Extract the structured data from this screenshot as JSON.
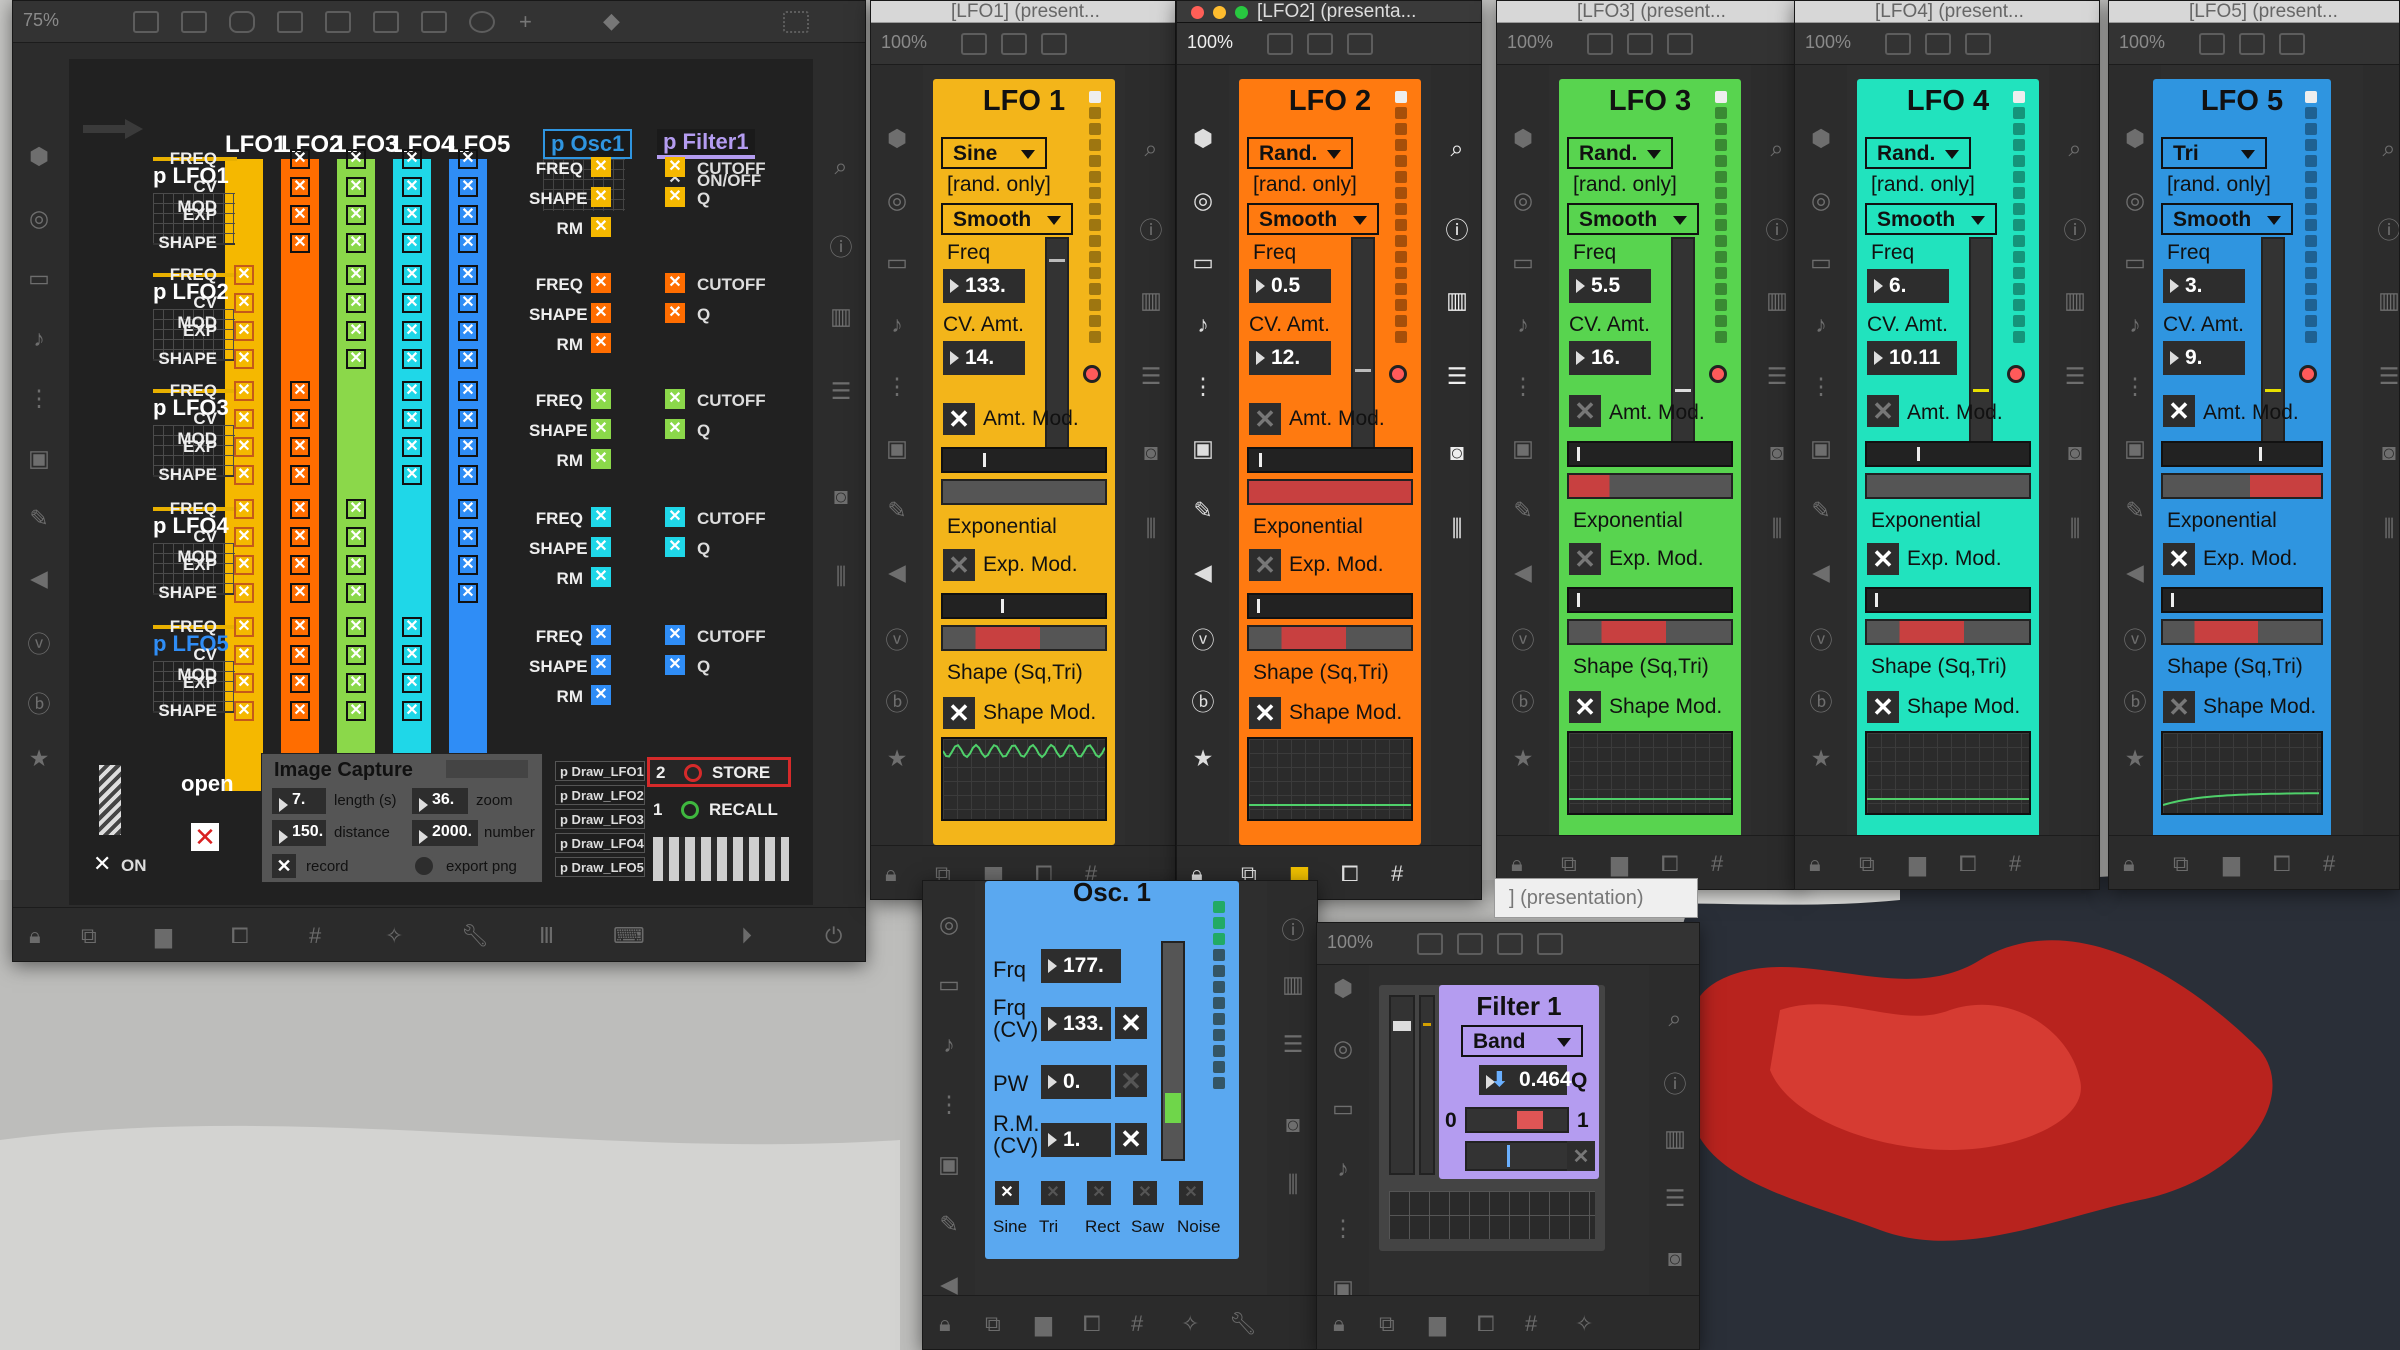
{
  "main_window": {
    "zoom": "75%"
  },
  "matrix": {
    "columns": [
      "LFO1",
      "LFO2",
      "LFO3",
      "LFO4",
      "LFO5"
    ],
    "column_colors": [
      "#f5b800",
      "#ff6d00",
      "#8bd84a",
      "#1fd7e8",
      "#2f8df6"
    ],
    "row_labels": [
      "FREQ",
      "CV MOD",
      "EXP",
      "SHAPE"
    ],
    "preset_names": [
      "p LFO1",
      "p LFO2",
      "p LFO3",
      "p LFO4",
      "p LFO5"
    ],
    "osc_label": "p Osc1",
    "osc_rows": [
      "FREQ",
      "SHAPE",
      "RM"
    ],
    "filter_label": "p Filter1",
    "filter_onoff": "ON/OFF",
    "filter_cutoff": "CUTOFF",
    "filter_q": "Q"
  },
  "controls": {
    "open_label": "open",
    "on_label": "ON"
  },
  "capture": {
    "title": "Image Capture",
    "length_value": "7.",
    "length_label": "length (s)",
    "zoom_value": "36.",
    "zoom_label": "zoom",
    "distance_value": "150.",
    "distance_label": "distance",
    "number_value": "2000.",
    "number_label": "number",
    "record_label": "record",
    "export_label": "export png",
    "draw_items": [
      "p Draw_LFO1",
      "p Draw_LFO2",
      "p Draw_LFO3",
      "p Draw_LFO4",
      "p Draw_LFO5"
    ],
    "store_num": "2",
    "store_label": "STORE",
    "recall_num": "1",
    "recall_label": "RECALL"
  },
  "window_titles": {
    "lfo1": "[LFO1] (present...",
    "lfo2": "[LFO2] (presenta...",
    "lfo3": "[LFO3] (present...",
    "lfo4": "[LFO4] (present...",
    "lfo5": "[LFO5] (present...",
    "osc": "] (presentation)"
  },
  "lfo_common": {
    "rand_only": "[rand. only]",
    "freq": "Freq",
    "cv_amt": "CV. Amt.",
    "amt_mod": "Amt. Mod.",
    "exponential": "Exponential",
    "exp_mod": "Exp. Mod.",
    "shape": "Shape (Sq,Tri)",
    "shape_mod": "Shape Mod."
  },
  "lfos": [
    {
      "title": "LFO 1",
      "zoom": "100%",
      "wave": "Sine",
      "mode": "Smooth",
      "freq": "133.",
      "cv": "14.",
      "color": "#f3b51a"
    },
    {
      "title": "LFO 2",
      "zoom": "100%",
      "wave": "Rand.",
      "mode": "Smooth",
      "freq": "0.5",
      "cv": "12.",
      "color": "#ff7a10"
    },
    {
      "title": "LFO 3",
      "zoom": "100%",
      "wave": "Rand.",
      "mode": "Smooth",
      "freq": "5.5",
      "cv": "16.",
      "color": "#58d44f"
    },
    {
      "title": "LFO 4",
      "zoom": "100%",
      "wave": "Rand.",
      "mode": "Smooth",
      "freq": "6.",
      "cv": "10.11",
      "color": "#21e3be"
    },
    {
      "title": "LFO 5",
      "zoom": "100%",
      "wave": "Tri",
      "mode": "Smooth",
      "freq": "3.",
      "cv": "9.",
      "color": "#2f95e0"
    }
  ],
  "osc": {
    "title": "Osc. 1",
    "frq_label": "Frq",
    "frq": "177.",
    "frq_cv_label": "Frq (CV)",
    "frq_cv": "133.",
    "pw_label": "PW",
    "pw": "0.",
    "rm_label": "R.M. (CV)",
    "rm": "1.",
    "waves": [
      "Sine",
      "Tri",
      "Rect",
      "Saw",
      "Noise"
    ]
  },
  "filter": {
    "zoom": "100%",
    "title": "Filter 1",
    "type": "Band",
    "q_value": "0.464",
    "q_label": "Q",
    "min": "0",
    "max": "1"
  },
  "colors": {
    "accent_yellow": "#f5b800",
    "accent_orange": "#ff6d00",
    "accent_green": "#58d44f",
    "accent_teal": "#21e3be",
    "accent_blue": "#2f95e0",
    "osc_blue": "#5aa8f0",
    "filter_purple": "#b49cf0"
  }
}
